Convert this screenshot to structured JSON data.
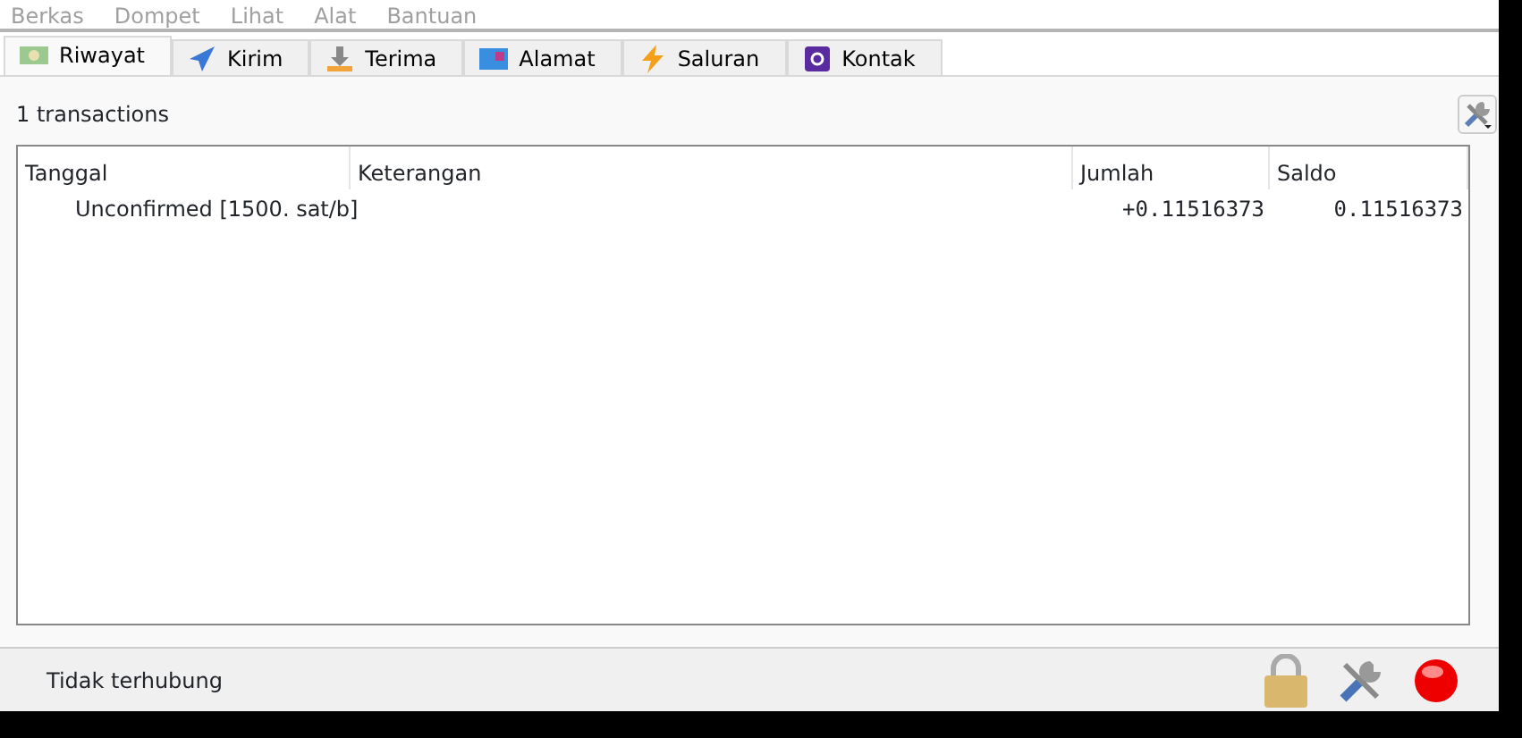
{
  "menu": [
    "Berkas",
    "Dompet",
    "Lihat",
    "Alat",
    "Bantuan"
  ],
  "tabs": [
    {
      "label": "Riwayat",
      "kind": "history",
      "selected": true
    },
    {
      "label": "Kirim",
      "kind": "send",
      "selected": false
    },
    {
      "label": "Terima",
      "kind": "receive",
      "selected": false
    },
    {
      "label": "Alamat",
      "kind": "addresses",
      "selected": false
    },
    {
      "label": "Saluran",
      "kind": "channels",
      "selected": false
    },
    {
      "label": "Kontak",
      "kind": "contacts",
      "selected": false
    }
  ],
  "summary": "1 transactions",
  "table": {
    "columns": [
      "Tanggal",
      "Keterangan",
      "Jumlah",
      "Saldo"
    ],
    "rows": [
      {
        "date": "Unconfirmed [1500. sat/b]",
        "description": "",
        "amount": "+0.11516373",
        "balance": "0.11516373"
      }
    ]
  },
  "status_bar": {
    "text": "Tidak terhubung"
  }
}
